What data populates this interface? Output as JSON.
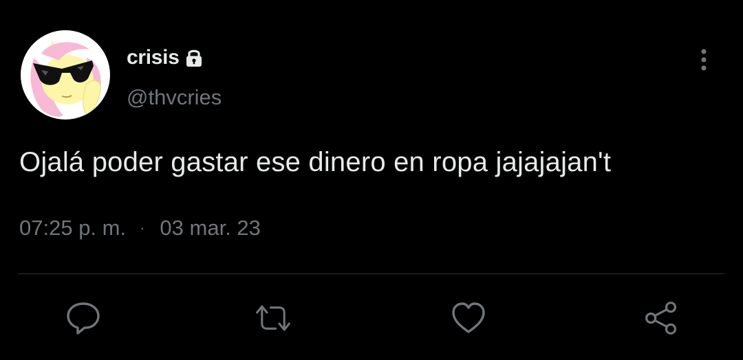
{
  "tweet": {
    "display_name": "crisis",
    "handle": "@thvcries",
    "text": "Ojalá poder gastar ese dinero en ropa jajajajan't",
    "time": "07:25 p. m.",
    "separator": "·",
    "date": "03 mar. 23"
  },
  "icons": {
    "lock": "lock-icon",
    "more": "more-vertical-icon",
    "reply": "reply-icon",
    "retweet": "retweet-icon",
    "like": "heart-icon",
    "share": "share-icon"
  },
  "colors": {
    "background": "#000000",
    "primary_text": "#e7e9ea",
    "secondary_text": "#71767b",
    "divider": "#2f3336",
    "avatar_bg": "#ffffff",
    "avatar_mane": "#f7b9d5",
    "avatar_coat": "#fdf6a8"
  }
}
